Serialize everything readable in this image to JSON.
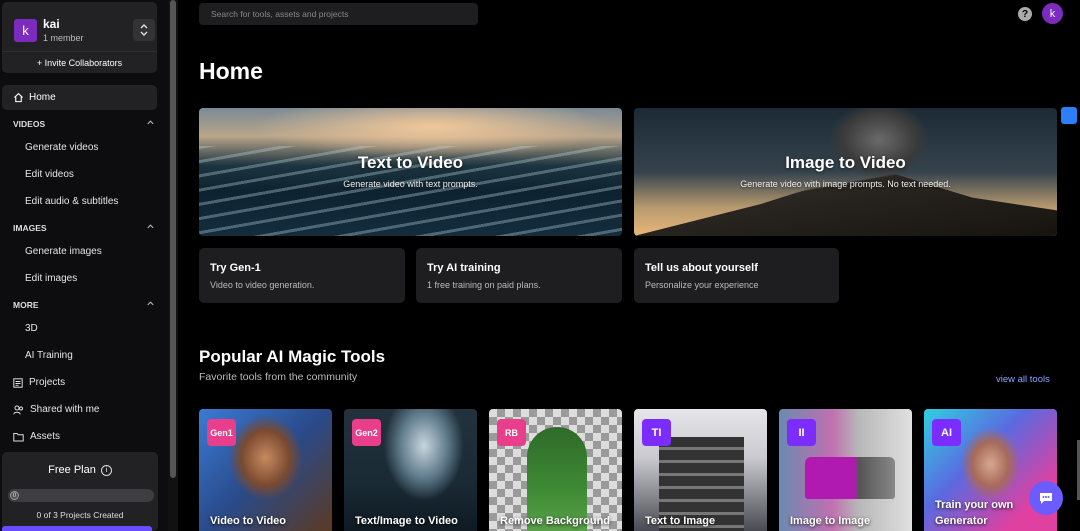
{
  "workspace": {
    "avatar_letter": "k",
    "name": "kai",
    "members": "1 member",
    "invite_label": "+ Invite Collaborators"
  },
  "nav": {
    "home": "Home",
    "sections": [
      {
        "title": "VIDEOS",
        "items": [
          "Generate videos",
          "Edit videos",
          "Edit audio & subtitles"
        ]
      },
      {
        "title": "IMAGES",
        "items": [
          "Generate images",
          "Edit images"
        ]
      },
      {
        "title": "MORE",
        "items": [
          "3D",
          "AI Training"
        ]
      }
    ],
    "projects": "Projects",
    "shared": "Shared with me",
    "assets": "Assets"
  },
  "plan": {
    "title": "Free Plan",
    "progress_value": "0",
    "progress_fraction": 0,
    "count_text": "0 of 3 Projects Created"
  },
  "search": {
    "placeholder": "Search for tools, assets and projects"
  },
  "user": {
    "avatar_letter": "k"
  },
  "page_title": "Home",
  "heroes": [
    {
      "title": "Text to Video",
      "subtitle": "Generate video with text prompts."
    },
    {
      "title": "Image to Video",
      "subtitle": "Generate video with image prompts. No text needed."
    }
  ],
  "cards": [
    {
      "title": "Try Gen-1",
      "subtitle": "Video to video generation."
    },
    {
      "title": "Try AI training",
      "subtitle": "1 free training on paid plans."
    },
    {
      "title": "Tell us about yourself",
      "subtitle": "Personalize your experience"
    }
  ],
  "popular": {
    "title": "Popular AI Magic Tools",
    "subtitle": "Favorite tools from the community",
    "view_all": "view all tools"
  },
  "tools": [
    {
      "badge": "Gen1",
      "label": "Video to Video"
    },
    {
      "badge": "Gen2",
      "label": "Text/Image to Video"
    },
    {
      "badge": "RB",
      "label": "Remove Background"
    },
    {
      "badge": "TI",
      "label": "Text to Image"
    },
    {
      "badge": "II",
      "label": "Image to Image"
    },
    {
      "badge": "AI",
      "label": "Train your own Generator"
    }
  ],
  "colors": {
    "accent": "#7b2cbf",
    "badge_pink": "#e83e8c",
    "badge_purple": "#7b2cff",
    "link": "#8aa4ff",
    "chat": "#6c5cff"
  }
}
